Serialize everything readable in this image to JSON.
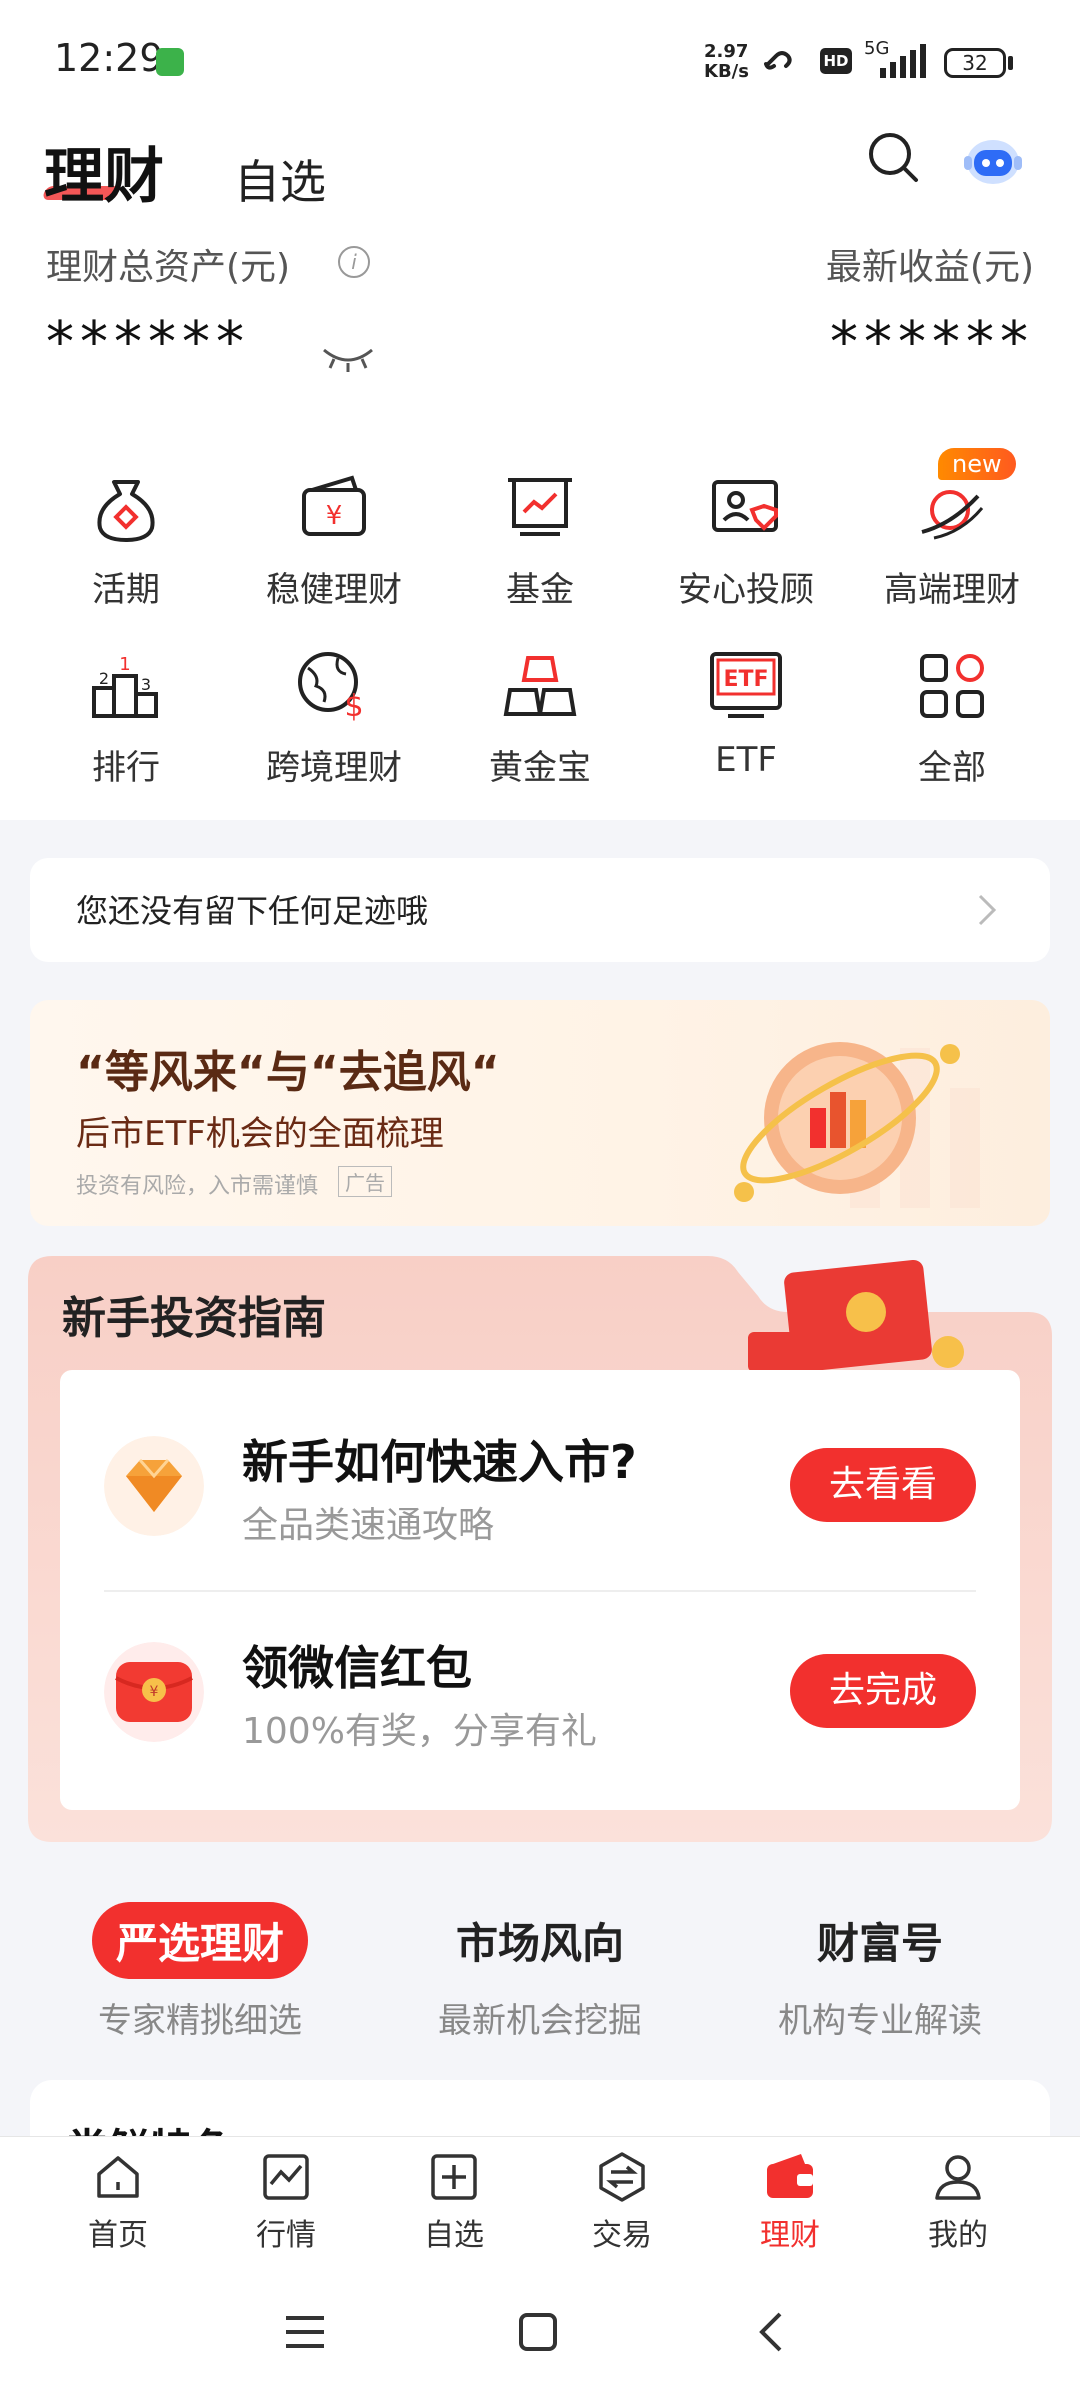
{
  "status_bar": {
    "time": "12:29",
    "net_speed_1": "2.97",
    "net_speed_2": "KB/s",
    "hd": "HD",
    "signal_label": "5G",
    "battery": "32"
  },
  "header": {
    "tab_active": "理财",
    "tab_inactive": "自选",
    "icons": [
      "search-icon",
      "robot-assistant-icon"
    ]
  },
  "assets": {
    "total_label": "理财总资产(元)",
    "total_value": "******",
    "earn_label": "最新收益(元)",
    "earn_value": "******"
  },
  "grid": [
    {
      "label": "活期",
      "icon": "money-bag-icon"
    },
    {
      "label": "稳健理财",
      "icon": "wallet-yen-icon"
    },
    {
      "label": "基金",
      "icon": "chart-board-icon"
    },
    {
      "label": "安心投顾",
      "icon": "advisor-card-icon"
    },
    {
      "label": "高端理财",
      "icon": "premium-icon",
      "badge": "new"
    },
    {
      "label": "排行",
      "icon": "podium-icon"
    },
    {
      "label": "跨境理财",
      "icon": "globe-dollar-icon"
    },
    {
      "label": "黄金宝",
      "icon": "gold-bar-icon"
    },
    {
      "label": "ETF",
      "icon": "etf-icon"
    },
    {
      "label": "全部",
      "icon": "all-grid-icon"
    }
  ],
  "footprint": {
    "text": "您还没有留下任何足迹哦"
  },
  "banner": {
    "title": "“等风来“与“去追风“",
    "subtitle": "后市ETF机会的全面梳理",
    "risk": "投资有风险，入市需谨慎",
    "ad": "广告"
  },
  "guide": {
    "title": "新手投资指南",
    "items": [
      {
        "title": "新手如何快速入市?",
        "subtitle": "全品类速通攻略",
        "button": "去看看"
      },
      {
        "title": "领微信红包",
        "subtitle": "100%有奖，分享有礼",
        "button": "去完成"
      }
    ]
  },
  "select_tabs": [
    {
      "title": "严选理财",
      "subtitle": "专家精挑细选"
    },
    {
      "title": "市场风向",
      "subtitle": "最新机会挖掘"
    },
    {
      "title": "财富号",
      "subtitle": "机构专业解读"
    }
  ],
  "bottom_peek": "尝鲜特色",
  "nav": [
    {
      "label": "首页",
      "icon": "home-icon"
    },
    {
      "label": "行情",
      "icon": "market-chart-icon"
    },
    {
      "label": "自选",
      "icon": "add-watchlist-icon"
    },
    {
      "label": "交易",
      "icon": "trade-icon"
    },
    {
      "label": "理财",
      "icon": "wallet-icon"
    },
    {
      "label": "我的",
      "icon": "profile-icon"
    }
  ],
  "colors": {
    "accent": "#f2302e",
    "banner_title": "#5a2a14",
    "background": "#f4f5f9"
  }
}
